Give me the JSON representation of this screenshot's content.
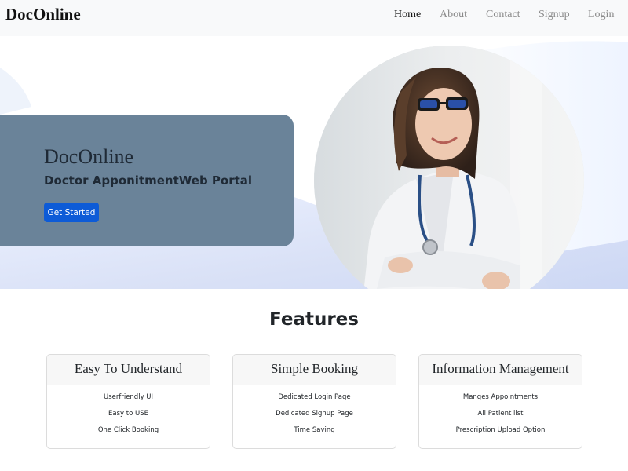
{
  "navbar": {
    "brand": "DocOnline",
    "links": [
      {
        "label": "Home",
        "active": true
      },
      {
        "label": "About",
        "active": false
      },
      {
        "label": "Contact",
        "active": false
      },
      {
        "label": "Signup",
        "active": false
      },
      {
        "label": "Login",
        "active": false
      }
    ]
  },
  "hero": {
    "title": "DocOnline",
    "subtitle": "Doctor ApponitmentWeb Portal",
    "cta_label": "Get Started",
    "image": "doctor-photo"
  },
  "features": {
    "heading": "Features",
    "cards": [
      {
        "title": "Easy To Understand",
        "items": [
          "Userfriendly UI",
          "Easy to USE",
          "One Click Booking"
        ]
      },
      {
        "title": "Simple Booking",
        "items": [
          "Dedicated Login Page",
          "Dedicated Signup Page",
          "Time Saving"
        ]
      },
      {
        "title": "Information Management",
        "items": [
          "Manges Appointments",
          "All Patient list",
          "Prescription Upload Option"
        ]
      }
    ]
  },
  "colors": {
    "navbar_bg": "#f8f9fa",
    "hero_card": "#6a8399",
    "primary_button": "#0d5bd7",
    "hero_wave": "#d3dcf5"
  }
}
